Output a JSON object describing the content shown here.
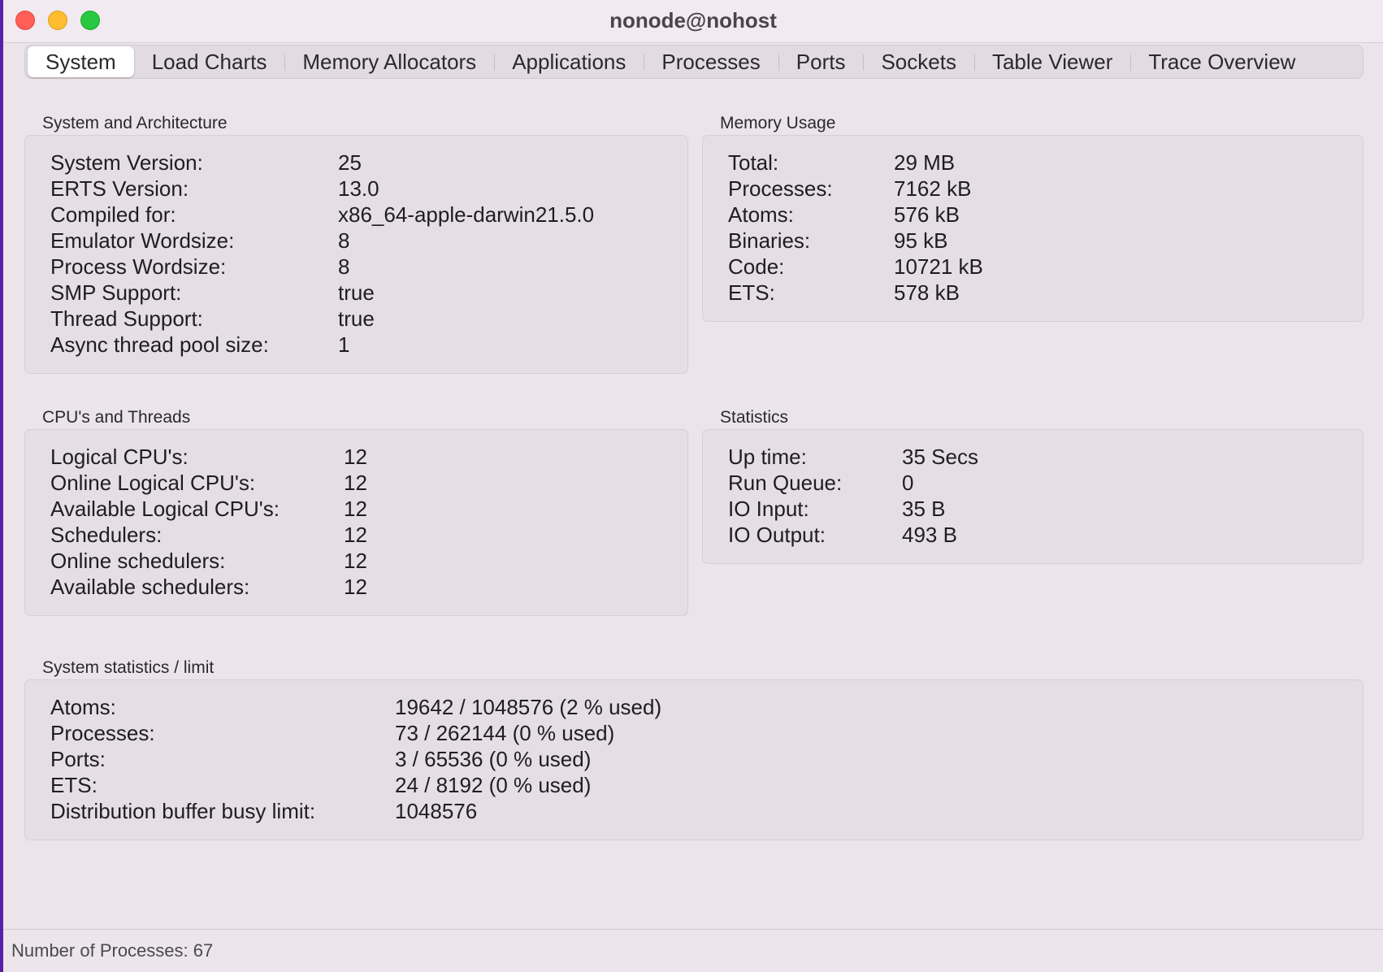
{
  "window": {
    "title": "nonode@nohost"
  },
  "tabs": [
    {
      "label": "System"
    },
    {
      "label": "Load Charts"
    },
    {
      "label": "Memory Allocators"
    },
    {
      "label": "Applications"
    },
    {
      "label": "Processes"
    },
    {
      "label": "Ports"
    },
    {
      "label": "Sockets"
    },
    {
      "label": "Table Viewer"
    },
    {
      "label": "Trace Overview"
    }
  ],
  "active_tab": "System",
  "system_arch": {
    "title": "System and Architecture",
    "rows": [
      {
        "label": "System Version:",
        "value": "25"
      },
      {
        "label": "ERTS Version:",
        "value": "13.0"
      },
      {
        "label": "Compiled for:",
        "value": "x86_64-apple-darwin21.5.0"
      },
      {
        "label": "Emulator Wordsize:",
        "value": "8"
      },
      {
        "label": "Process Wordsize:",
        "value": "8"
      },
      {
        "label": "SMP Support:",
        "value": "true"
      },
      {
        "label": "Thread Support:",
        "value": "true"
      },
      {
        "label": "Async thread pool size:",
        "value": "1"
      }
    ]
  },
  "memory_usage": {
    "title": "Memory Usage",
    "rows": [
      {
        "label": "Total:",
        "value": "29 MB"
      },
      {
        "label": "Processes:",
        "value": "7162 kB"
      },
      {
        "label": "Atoms:",
        "value": "576 kB"
      },
      {
        "label": "Binaries:",
        "value": "95 kB"
      },
      {
        "label": "Code:",
        "value": "10721 kB"
      },
      {
        "label": "ETS:",
        "value": "578 kB"
      }
    ]
  },
  "cpus_threads": {
    "title": "CPU's and Threads",
    "rows": [
      {
        "label": "Logical CPU's:",
        "value": "12"
      },
      {
        "label": "Online Logical CPU's:",
        "value": "12"
      },
      {
        "label": "Available Logical CPU's:",
        "value": "12"
      },
      {
        "label": "Schedulers:",
        "value": "12"
      },
      {
        "label": "Online schedulers:",
        "value": "12"
      },
      {
        "label": "Available schedulers:",
        "value": "12"
      }
    ]
  },
  "statistics": {
    "title": "Statistics",
    "rows": [
      {
        "label": "Up time:",
        "value": "35 Secs"
      },
      {
        "label": "Run Queue:",
        "value": "0"
      },
      {
        "label": "IO Input:",
        "value": "35 B"
      },
      {
        "label": "IO Output:",
        "value": "493 B"
      }
    ]
  },
  "system_limits": {
    "title": "System statistics / limit",
    "rows": [
      {
        "label": "Atoms:",
        "value": "19642 / 1048576 (2 % used)"
      },
      {
        "label": "Processes:",
        "value": "73 / 262144 (0 % used)"
      },
      {
        "label": "Ports:",
        "value": "3 / 65536 (0 % used)"
      },
      {
        "label": "ETS:",
        "value": "24 / 8192 (0 % used)"
      },
      {
        "label": "Distribution buffer busy limit:",
        "value": "1048576"
      }
    ]
  },
  "status_bar": {
    "text": "Number of Processes: 67"
  },
  "colors": {
    "close": "#ff5f57",
    "minimize": "#febc2e",
    "zoom": "#28c840",
    "window_bg": "#ebe5eb",
    "desktop_bg": "#5a1fa8"
  }
}
